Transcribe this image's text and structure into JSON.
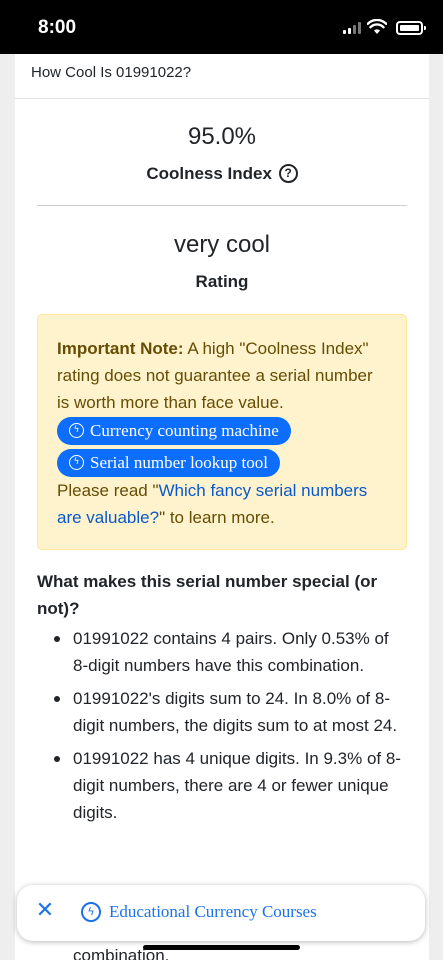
{
  "status_bar": {
    "time": "8:00"
  },
  "page_title": "How Cool Is 01991022?",
  "coolness": {
    "value": "95.0%",
    "label": "Coolness Index",
    "help_glyph": "?"
  },
  "rating": {
    "value": "very cool",
    "label": "Rating"
  },
  "note": {
    "strong": "Important Note:",
    "text": " A high \"Coolness Index\" rating does not guarantee a serial number is worth more than face value.",
    "chip1": "Currency counting machine",
    "chip2": "Serial number lookup tool",
    "pre_link": "Please read \"",
    "link": "Which fancy serial numbers are valuable?",
    "post_link": "\" to learn more."
  },
  "section_heading": "What makes this serial number special (or not)?",
  "facts": [
    "01991022 contains 4 pairs. Only 0.53% of 8-digit numbers have this combination.",
    "01991022's digits sum to 24. In 8.0% of 8-digit numbers, the digits sum to at most 24.",
    "01991022 has 4 unique digits. In 9.3% of 8-digit numbers, there are 4 or fewer unique digits."
  ],
  "partial_text": "combination.",
  "banner": {
    "close_glyph": "✕",
    "link": "Educational Currency Courses"
  },
  "icons": {
    "bolt": "ϟ"
  },
  "colors": {
    "chip_blue": "#0d6efd",
    "note_bg": "#fff3cd",
    "note_text": "#664d03",
    "link": "#1a73e8"
  }
}
